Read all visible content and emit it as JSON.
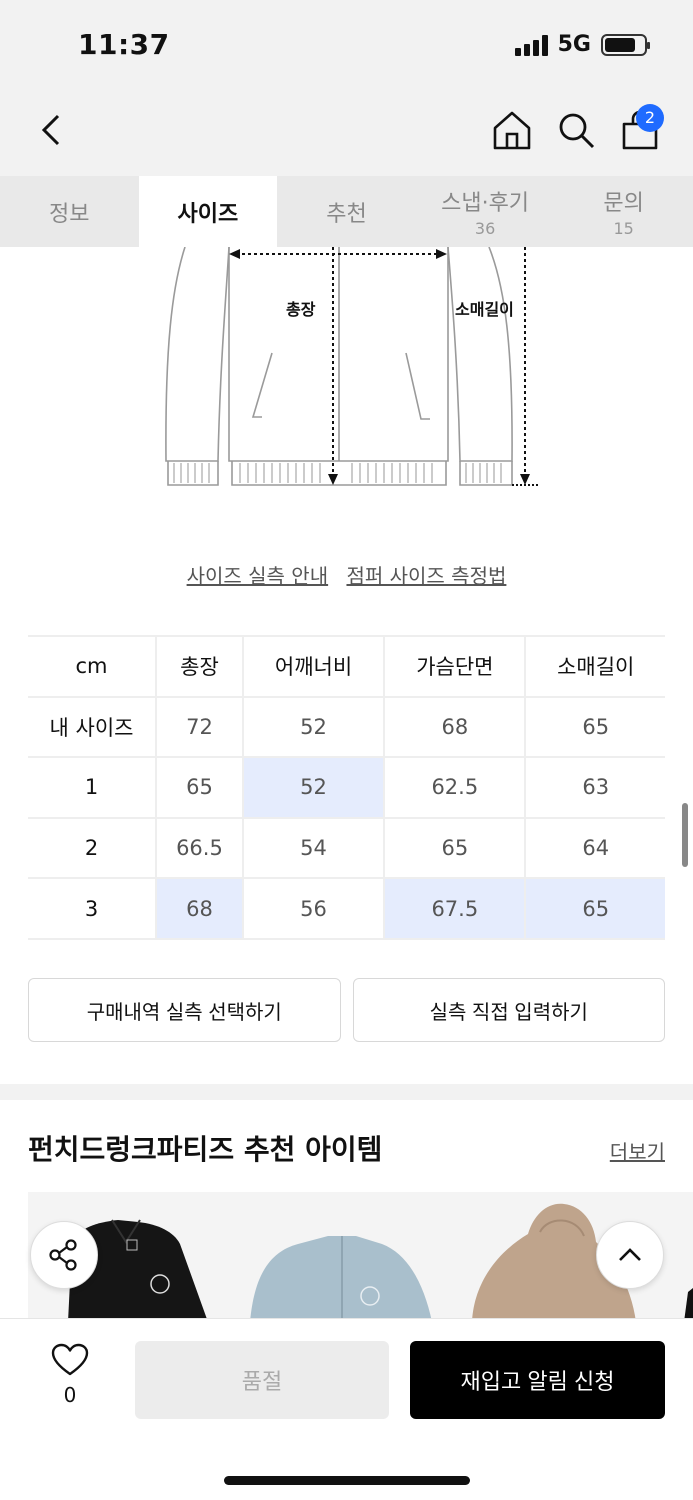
{
  "status": {
    "time": "11:37",
    "network": "5G"
  },
  "header": {
    "cart_count": "2"
  },
  "tabs": [
    {
      "label": "정보",
      "count": ""
    },
    {
      "label": "사이즈",
      "count": ""
    },
    {
      "label": "추천",
      "count": ""
    },
    {
      "label": "스냅·후기",
      "count": "36"
    },
    {
      "label": "문의",
      "count": "15"
    }
  ],
  "diagram": {
    "length_label": "총장",
    "sleeve_label": "소매길이"
  },
  "guide_links": {
    "actual_size": "사이즈 실측 안내",
    "how_to_measure": "점퍼 사이즈 측정법"
  },
  "size_table": {
    "headers": [
      "cm",
      "총장",
      "어깨너비",
      "가슴단면",
      "소매길이"
    ],
    "rows": [
      {
        "label": "내 사이즈",
        "values": [
          "72",
          "52",
          "68",
          "65"
        ]
      },
      {
        "label": "1",
        "values": [
          "65",
          "52",
          "62.5",
          "63"
        ]
      },
      {
        "label": "2",
        "values": [
          "66.5",
          "54",
          "65",
          "64"
        ]
      },
      {
        "label": "3",
        "values": [
          "68",
          "56",
          "67.5",
          "65"
        ]
      }
    ]
  },
  "buttons": {
    "purchase_history": "구매내역 실측 선택하기",
    "direct_input": "실측 직접 입력하기"
  },
  "recommend": {
    "title": "펀치드렁크파티즈 추천 아이템",
    "more": "더보기"
  },
  "bottom_bar": {
    "like_count": "0",
    "sold_out": "품절",
    "restock_alert": "재입고 알림 신청"
  },
  "colors": {
    "accent_badge": "#1f6bff",
    "highlight_cell": "#e5ecfd"
  }
}
